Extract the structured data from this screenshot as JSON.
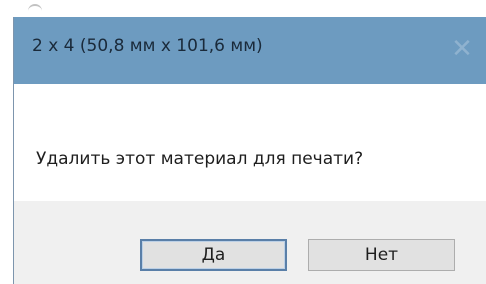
{
  "dialog": {
    "title": "2 x 4 (50,8 мм x 101,6 мм)",
    "close_glyph": "✕",
    "message": "Удалить этот материал для печати?",
    "buttons": {
      "yes_label": "Да",
      "no_label": "Нет"
    }
  },
  "colors": {
    "titlebar": "#6d9bc0",
    "footer": "#f0f0f0",
    "button_face": "#e1e1e1",
    "default_button_border": "#5a7fa8"
  }
}
